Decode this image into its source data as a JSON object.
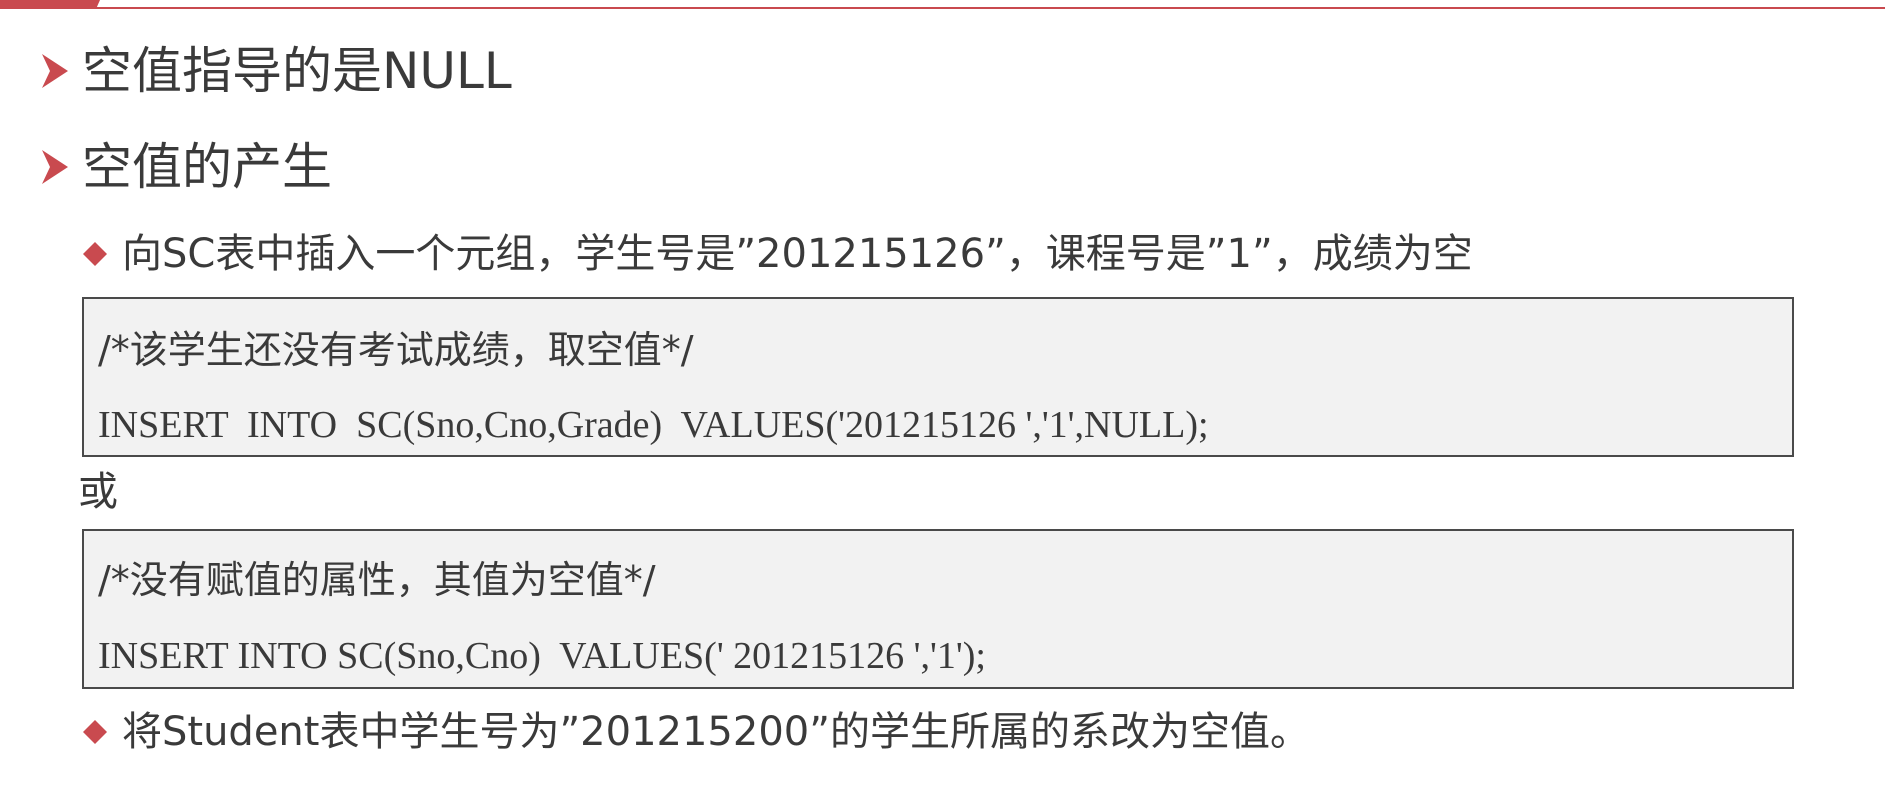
{
  "slide": {
    "bullets": [
      {
        "text": "空值指导的是NULL"
      },
      {
        "text": "空值的产生"
      }
    ],
    "sub_bullets": [
      {
        "text": "向SC表中插入一个元组，学生号是”201215126”，课程号是”1”，成绩为空"
      },
      {
        "text": "将Student表中学生号为”201215200”的学生所属的系改为空值。"
      }
    ],
    "code_blocks": [
      {
        "comment": " /*该学生还没有考试成绩，取空值*/",
        "code": "INSERT  INTO  SC(Sno,Cno,Grade)  VALUES('201215126 ','1',NULL);"
      },
      {
        "comment": "/*没有赋值的属性，其值为空值*/",
        "code": "INSERT INTO SC(Sno,Cno)  VALUES(' 201215126 ','1');"
      }
    ],
    "or_label": "或"
  },
  "colors": {
    "accent": "#c94a4f",
    "text": "#3a3a3a",
    "code_bg": "#f2f2f2"
  },
  "icons": {
    "level1": "arrow-right-icon",
    "level2": "diamond-icon"
  }
}
